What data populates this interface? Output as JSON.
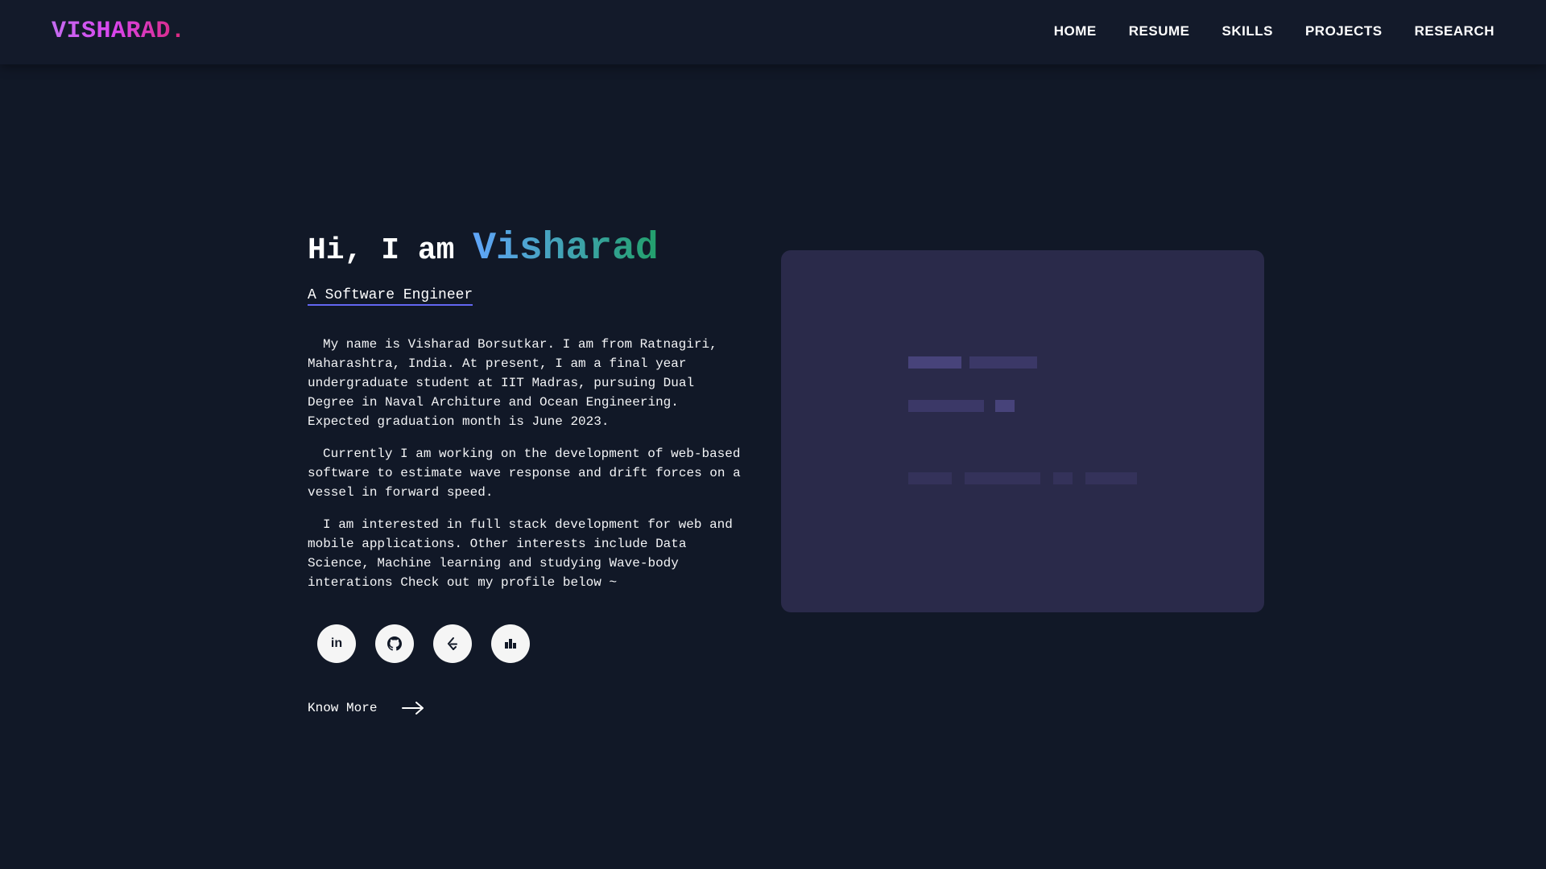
{
  "nav": {
    "brand": "VISHARAD.",
    "links": [
      "HOME",
      "RESUME",
      "SKILLS",
      "PROJECTS",
      "RESEARCH"
    ]
  },
  "hero": {
    "greeting": "Hi, I am",
    "name": "Visharad",
    "subtitle": "A Software Engineer",
    "paragraphs": [
      "My name is Visharad Borsutkar. I am from Ratnagiri, Maharashtra, India. At present, I am a final year undergraduate student at IIT Madras, pursuing Dual Degree in Naval Architure and Ocean Engineering. Expected graduation month is June 2023.",
      "Currently I am working on the development of web-based software to estimate wave response and drift forces on a vessel in forward speed.",
      "I am interested in full stack development for web and mobile applications. Other interests include Data Science, Machine learning and studying Wave-body interations Check out my profile below ~"
    ],
    "socials": [
      {
        "icon": "linkedin-icon",
        "glyph": "in"
      },
      {
        "icon": "github-icon"
      },
      {
        "icon": "leetcode-icon"
      },
      {
        "icon": "kaggle-stats-icon"
      }
    ],
    "know_more": "Know More"
  },
  "colors": {
    "background": "#111827",
    "navbar": "#131a2a",
    "panel": "#2a2a4a",
    "accent_underline": "#6366f1"
  }
}
